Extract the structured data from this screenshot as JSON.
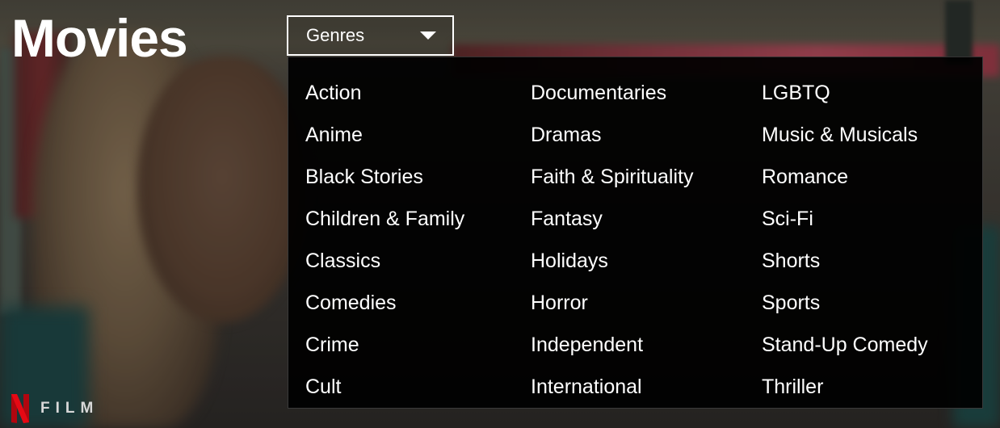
{
  "page": {
    "title": "Movies"
  },
  "genre_selector": {
    "label": "Genres",
    "icon": "caret-down-icon",
    "expanded": true
  },
  "genres": {
    "columns": [
      [
        "Action",
        "Anime",
        "Black Stories",
        "Children & Family",
        "Classics",
        "Comedies",
        "Crime",
        "Cult"
      ],
      [
        "Documentaries",
        "Dramas",
        "Faith & Spirituality",
        "Fantasy",
        "Holidays",
        "Horror",
        "Independent",
        "International"
      ],
      [
        "LGBTQ",
        "Music & Musicals",
        "Romance",
        "Sci-Fi",
        "Shorts",
        "Sports",
        "Stand-Up Comedy",
        "Thriller"
      ]
    ]
  },
  "brand": {
    "logo_icon": "netflix-n-icon",
    "label": "FILM",
    "logo_color": "#e50914"
  },
  "colors": {
    "text": "#ffffff",
    "panel_bg": "#000000"
  }
}
